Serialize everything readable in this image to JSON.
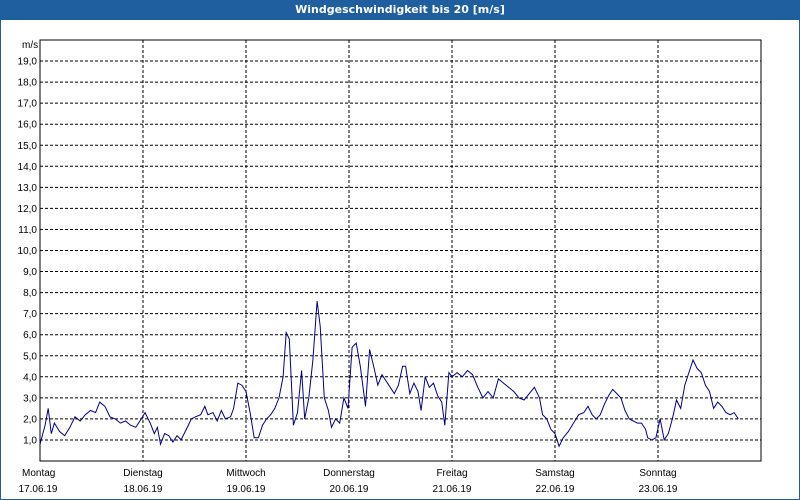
{
  "window": {
    "title": "Windgeschwindigkeit bis 20 [m/s]"
  },
  "colors": {
    "titlebar": "#1f5fa0",
    "series": "#00008b",
    "grid": "#000000"
  },
  "chart_data": {
    "type": "line",
    "ylabel": "m/s",
    "ylim": [
      0,
      20
    ],
    "yticks": [
      "1,0",
      "2,0",
      "3,0",
      "4,0",
      "5,0",
      "6,0",
      "7,0",
      "8,0",
      "9,0",
      "10,0",
      "11,0",
      "12,0",
      "13,0",
      "14,0",
      "15,0",
      "16,0",
      "17,0",
      "18,0",
      "19,0"
    ],
    "x_range_days": [
      0,
      7
    ],
    "days": [
      {
        "day": "Montag",
        "date": "17.06.19"
      },
      {
        "day": "Dienstag",
        "date": "18.06.19"
      },
      {
        "day": "Mittwoch",
        "date": "19.06.19"
      },
      {
        "day": "Donnerstag",
        "date": "20.06.19"
      },
      {
        "day": "Freitag",
        "date": "21.06.19"
      },
      {
        "day": "Samstag",
        "date": "22.06.19"
      },
      {
        "day": "Sonntag",
        "date": "23.06.19"
      }
    ],
    "grid": true,
    "series": [
      {
        "values": [
          [
            0.0,
            0.8
          ],
          [
            0.05,
            1.7
          ],
          [
            0.08,
            2.5
          ],
          [
            0.11,
            1.3
          ],
          [
            0.14,
            1.8
          ],
          [
            0.19,
            1.4
          ],
          [
            0.24,
            1.2
          ],
          [
            0.29,
            1.6
          ],
          [
            0.34,
            2.1
          ],
          [
            0.39,
            1.9
          ],
          [
            0.44,
            2.2
          ],
          [
            0.49,
            2.4
          ],
          [
            0.54,
            2.3
          ],
          [
            0.58,
            2.8
          ],
          [
            0.63,
            2.6
          ],
          [
            0.68,
            2.1
          ],
          [
            0.73,
            2.0
          ],
          [
            0.78,
            1.8
          ],
          [
            0.83,
            1.9
          ],
          [
            0.88,
            1.7
          ],
          [
            0.93,
            1.6
          ],
          [
            0.97,
            1.9
          ],
          [
            1.02,
            2.3
          ],
          [
            1.07,
            1.8
          ],
          [
            1.11,
            1.3
          ],
          [
            1.14,
            1.6
          ],
          [
            1.17,
            0.8
          ],
          [
            1.21,
            1.3
          ],
          [
            1.25,
            1.2
          ],
          [
            1.29,
            0.9
          ],
          [
            1.33,
            1.2
          ],
          [
            1.37,
            1.0
          ],
          [
            1.42,
            1.5
          ],
          [
            1.47,
            2.0
          ],
          [
            1.51,
            2.1
          ],
          [
            1.56,
            2.2
          ],
          [
            1.6,
            2.6
          ],
          [
            1.63,
            2.2
          ],
          [
            1.68,
            2.3
          ],
          [
            1.72,
            1.9
          ],
          [
            1.76,
            2.4
          ],
          [
            1.8,
            2.0
          ],
          [
            1.85,
            2.1
          ],
          [
            1.88,
            2.5
          ],
          [
            1.92,
            3.7
          ],
          [
            1.96,
            3.6
          ],
          [
            2.0,
            3.3
          ],
          [
            2.04,
            2.3
          ],
          [
            2.08,
            1.1
          ],
          [
            2.12,
            1.1
          ],
          [
            2.16,
            1.7
          ],
          [
            2.2,
            2.0
          ],
          [
            2.24,
            2.2
          ],
          [
            2.28,
            2.5
          ],
          [
            2.32,
            3.0
          ],
          [
            2.36,
            4.0
          ],
          [
            2.39,
            6.1
          ],
          [
            2.42,
            5.8
          ],
          [
            2.46,
            1.7
          ],
          [
            2.5,
            2.3
          ],
          [
            2.54,
            4.3
          ],
          [
            2.57,
            2.0
          ],
          [
            2.61,
            3.0
          ],
          [
            2.65,
            4.8
          ],
          [
            2.69,
            7.6
          ],
          [
            2.72,
            6.4
          ],
          [
            2.76,
            3.0
          ],
          [
            2.8,
            2.4
          ],
          [
            2.83,
            1.6
          ],
          [
            2.87,
            2.0
          ],
          [
            2.91,
            1.8
          ],
          [
            2.95,
            3.0
          ],
          [
            2.99,
            2.5
          ],
          [
            3.03,
            5.4
          ],
          [
            3.07,
            5.6
          ],
          [
            3.11,
            4.5
          ],
          [
            3.16,
            2.6
          ],
          [
            3.2,
            5.3
          ],
          [
            3.24,
            4.5
          ],
          [
            3.28,
            3.6
          ],
          [
            3.32,
            4.1
          ],
          [
            3.36,
            3.8
          ],
          [
            3.4,
            3.5
          ],
          [
            3.44,
            3.2
          ],
          [
            3.48,
            3.6
          ],
          [
            3.52,
            4.5
          ],
          [
            3.55,
            4.5
          ],
          [
            3.59,
            3.2
          ],
          [
            3.63,
            3.7
          ],
          [
            3.67,
            3.3
          ],
          [
            3.7,
            2.4
          ],
          [
            3.74,
            4.0
          ],
          [
            3.78,
            3.5
          ],
          [
            3.82,
            3.7
          ],
          [
            3.86,
            3.1
          ],
          [
            3.9,
            2.8
          ],
          [
            3.93,
            1.7
          ],
          [
            3.97,
            4.2
          ],
          [
            4.0,
            4.0
          ],
          [
            4.05,
            4.2
          ],
          [
            4.1,
            4.0
          ],
          [
            4.15,
            4.3
          ],
          [
            4.2,
            4.1
          ],
          [
            4.25,
            3.5
          ],
          [
            4.3,
            3.0
          ],
          [
            4.35,
            3.3
          ],
          [
            4.4,
            3.0
          ],
          [
            4.45,
            3.9
          ],
          [
            4.5,
            3.7
          ],
          [
            4.55,
            3.5
          ],
          [
            4.6,
            3.3
          ],
          [
            4.65,
            3.0
          ],
          [
            4.7,
            2.9
          ],
          [
            4.75,
            3.2
          ],
          [
            4.8,
            3.5
          ],
          [
            4.85,
            3.0
          ],
          [
            4.88,
            2.2
          ],
          [
            4.92,
            2.0
          ],
          [
            4.96,
            1.5
          ],
          [
            5.0,
            1.3
          ],
          [
            5.04,
            0.7
          ],
          [
            5.08,
            1.1
          ],
          [
            5.13,
            1.4
          ],
          [
            5.18,
            1.8
          ],
          [
            5.23,
            2.2
          ],
          [
            5.28,
            2.3
          ],
          [
            5.32,
            2.6
          ],
          [
            5.36,
            2.2
          ],
          [
            5.4,
            2.0
          ],
          [
            5.44,
            2.2
          ],
          [
            5.48,
            2.7
          ],
          [
            5.52,
            3.1
          ],
          [
            5.56,
            3.4
          ],
          [
            5.6,
            3.2
          ],
          [
            5.64,
            3.0
          ],
          [
            5.68,
            2.4
          ],
          [
            5.72,
            2.0
          ],
          [
            5.76,
            1.9
          ],
          [
            5.8,
            1.8
          ],
          [
            5.84,
            1.8
          ],
          [
            5.88,
            1.5
          ],
          [
            5.9,
            1.1
          ],
          [
            5.94,
            1.0
          ],
          [
            5.98,
            1.1
          ],
          [
            6.02,
            2.0
          ],
          [
            6.06,
            1.0
          ],
          [
            6.1,
            1.3
          ],
          [
            6.14,
            2.0
          ],
          [
            6.18,
            2.9
          ],
          [
            6.22,
            2.5
          ],
          [
            6.26,
            3.6
          ],
          [
            6.3,
            4.2
          ],
          [
            6.34,
            4.8
          ],
          [
            6.38,
            4.4
          ],
          [
            6.42,
            4.2
          ],
          [
            6.46,
            3.6
          ],
          [
            6.5,
            3.3
          ],
          [
            6.54,
            2.5
          ],
          [
            6.58,
            2.8
          ],
          [
            6.62,
            2.6
          ],
          [
            6.66,
            2.3
          ],
          [
            6.7,
            2.2
          ],
          [
            6.74,
            2.3
          ],
          [
            6.78,
            2.0
          ]
        ]
      }
    ]
  }
}
